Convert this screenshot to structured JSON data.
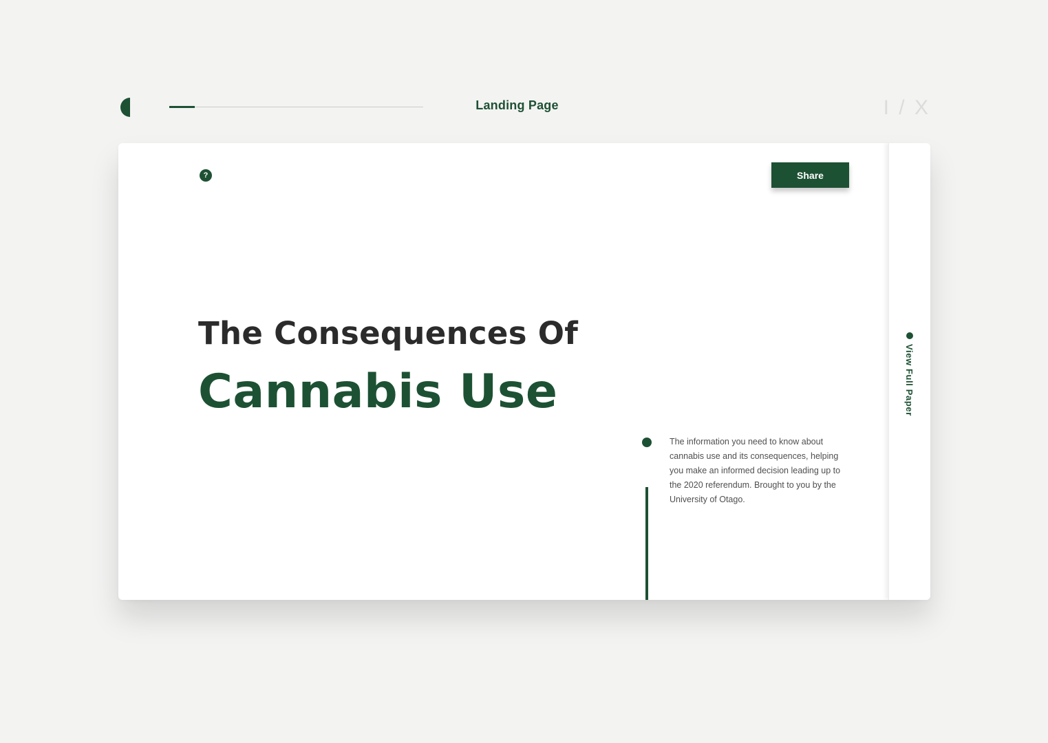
{
  "header": {
    "page_label": "Landing Page",
    "page_counter": "I / X",
    "progress_fraction": 0.1,
    "logo_icon": "half-circle-logo-icon"
  },
  "card": {
    "help_icon": {
      "name": "question-icon",
      "glyph": "?"
    },
    "share_label": "Share",
    "title_line1": "The Consequences Of",
    "title_line2": "Cannabis Use",
    "description": "The information you need to know about cannabis use and its consequences, helping you make an informed decision leading up to the 2020 referendum. Brought to you by the University of Otago.",
    "sidebar": {
      "label": "View Full Paper",
      "icon": "half-circle-icon"
    }
  },
  "colors": {
    "accent": "#1d5133",
    "background": "#f3f3f2",
    "title_dark": "#2b2b2b",
    "body_text": "#4f4f4f",
    "counter": "#dcdcdc"
  }
}
